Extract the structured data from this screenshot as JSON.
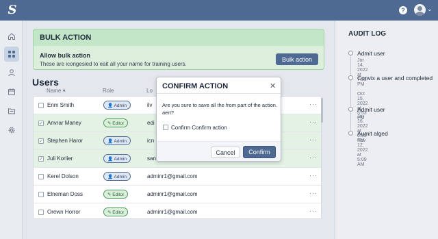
{
  "app": {
    "logo": "S",
    "help": "?",
    "avatar_caret": "⌄"
  },
  "sidebar": {
    "items": [
      {
        "name": "home",
        "icon": "home-icon",
        "active": false
      },
      {
        "name": "dashboard",
        "icon": "grid-icon",
        "active": true
      },
      {
        "name": "users",
        "icon": "user-icon",
        "active": false
      },
      {
        "name": "calendar",
        "icon": "calendar-icon",
        "active": false
      },
      {
        "name": "files",
        "icon": "folder-icon",
        "active": false
      },
      {
        "name": "settings",
        "icon": "gear-icon",
        "active": false
      }
    ]
  },
  "bulk": {
    "header": "BULK ACTION",
    "title": "Allow bulk action",
    "description": "These are icongesied to eait all your name for training users.",
    "button": "Bulk action"
  },
  "users": {
    "title": "Users",
    "columns": {
      "name": "Name",
      "name_sort": "▾",
      "role": "Role",
      "login": "Lo"
    },
    "rows": [
      {
        "name": "Enm Smith",
        "role": "Admin",
        "email": "ilv",
        "selected": false,
        "more": "···"
      },
      {
        "name": "Anvrar Maney",
        "role": "Editor",
        "email": "edi",
        "selected": true,
        "more": "···"
      },
      {
        "name": "Stephen Haror",
        "role": "Admin",
        "email": "icn",
        "selected": true,
        "more": "···"
      },
      {
        "name": "Juli Korlier",
        "role": "Admin",
        "email": "san",
        "selected": true,
        "more": "···"
      },
      {
        "name": "Kerel Dolson",
        "role": "Admin",
        "email": "adminr1@gmail.com",
        "selected": false,
        "more": "···"
      },
      {
        "name": "Elneman Doss",
        "role": "Editor",
        "email": "adminr1@gmail.com",
        "selected": false,
        "more": "···"
      },
      {
        "name": "Orewn Horror",
        "role": "Editor",
        "email": "adminr1@gmail.com",
        "selected": false,
        "more": "···"
      }
    ]
  },
  "modal": {
    "title": "CONFIRM ACTION",
    "close": "✕",
    "body": "Are you sure to save all the from part of the action. aert?",
    "checkbox_label": "Confirm Confirm action",
    "cancel": "Cancel",
    "confirm": "Confirm"
  },
  "audit": {
    "title": "AUDIT LOG",
    "events": [
      {
        "text": "Admit user",
        "date": "Jor 14, 2022 at 7:53 PM"
      },
      {
        "text": "Convix a user and completed",
        "date": "Oct 15, 2022 at 5:53 PM"
      },
      {
        "text": "Admit user",
        "date": "Jor 16, 2022 at 5:59 PM"
      },
      {
        "text": "Aumit alged",
        "date": "Nov 12, 2022 at 5:09 AM"
      }
    ]
  },
  "colors": {
    "primary": "#4f6a92",
    "success_bg": "#dcefdd",
    "success_border": "#9fd3a6",
    "row_selected": "#e3f2e5"
  }
}
